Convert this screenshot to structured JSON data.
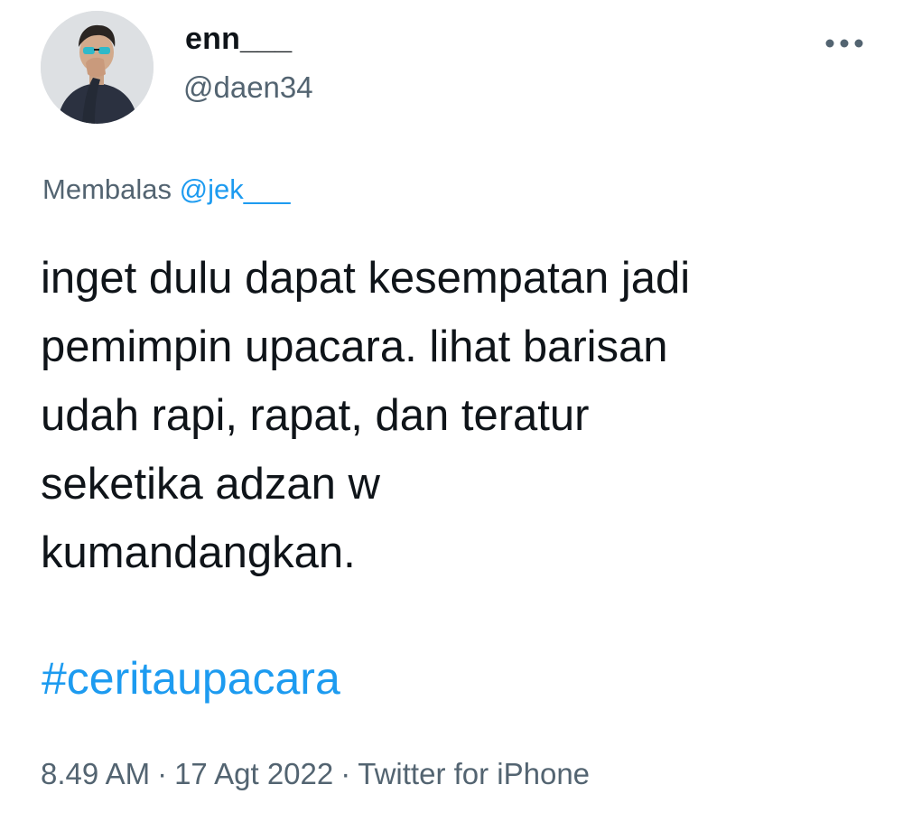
{
  "user": {
    "display_name": "enn___",
    "handle": "@daen34"
  },
  "menu": {
    "icon": "more-horizontal-icon"
  },
  "reply": {
    "prefix": "Membalas",
    "mention": "@jek___"
  },
  "tweet": {
    "lines": [
      "inget dulu dapat kesempatan jadi",
      "pemimpin upacara. lihat barisan",
      "udah rapi, rapat, dan teratur",
      "seketika adzan w",
      "kumandangkan."
    ],
    "hashtag": "#ceritaupacara"
  },
  "meta": {
    "time": "8.49 AM",
    "separator": "·",
    "date": "17 Agt 2022",
    "source": "Twitter for iPhone"
  },
  "colors": {
    "text": "#0f1419",
    "secondary": "#536471",
    "accent": "#1d9bf0"
  }
}
